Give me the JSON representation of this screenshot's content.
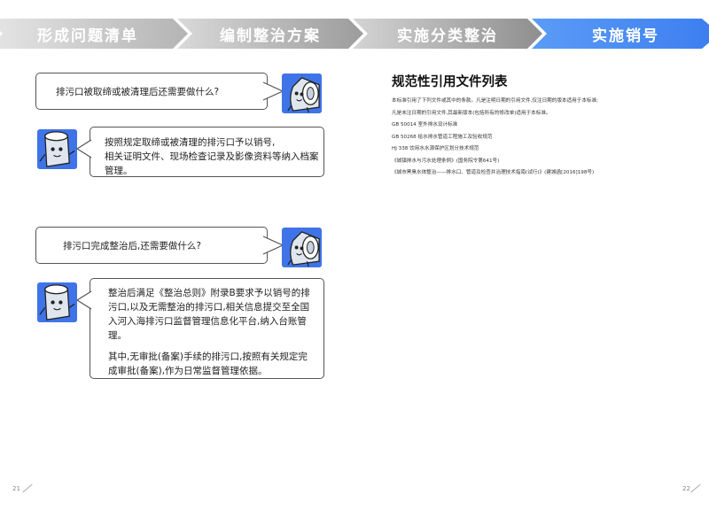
{
  "banner": {
    "steps": [
      "形成问题清单",
      "编制整治方案",
      "实施分类整治",
      "实施销号"
    ],
    "active_color": "#3c7df0"
  },
  "qa": [
    {
      "question": "排污口被取缔或被清理后还需要做什么?",
      "answer": [
        "按照规定取缔或被清理的排污口予以销号,",
        "相关证明文件、现场检查记录及影像资料等纳入档案管理。"
      ]
    },
    {
      "question": "排污口完成整治后,还需要做什么?",
      "answer": [
        "整治后满足《整治总则》附录B要求予以销号的排污口,以及无需整治的排污口,相关信息提交至全国入河入海排污口监督管理信息化平台,纳入台账管理。",
        "其中,无审批(备案)手续的排污口,按照有关规定完成审批(备案),作为日常监督管理依据。"
      ]
    }
  ],
  "references": {
    "title": "规范性引用文件列表",
    "lines": [
      "本标准引用了下列文件或其中的条款。凡是注明日期的引用文件,仅注日期的版本适用于本标准;",
      "凡是未注日期的引用文件,其最新版本(包括所有的修改单)适用于本标准。",
      "GB 50014 室外排水设计标准",
      "GB 50268 给水排水管道工程施工及验收规范",
      "HJ 338 饮用水水源保护区划分技术规范",
      "《城镇排水与污水处理条例》(国务院令第641号)",
      "《城市黑臭水体整治——排水口、管道及检查井治理技术指南(试行)》(建城函[2016]198号)"
    ]
  },
  "page_numbers": {
    "left": "21",
    "right": "22"
  },
  "icons": {
    "mascot": "pipe-mascot-icon"
  }
}
